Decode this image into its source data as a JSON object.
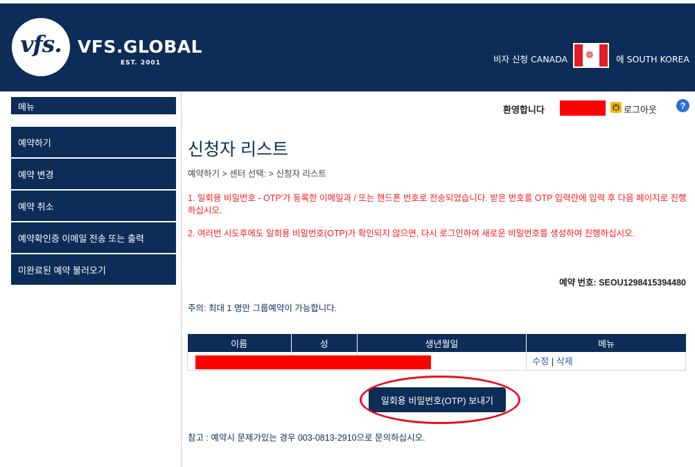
{
  "header": {
    "logo_text": "vfs.",
    "brand": "VFS.GLOBAL",
    "established": "EST. 2001",
    "visa_prefix": "비자 신청 CANADA",
    "flag_icon": "canada-flag-icon",
    "location_text": "에 SOUTH KOREA",
    "colors": {
      "navy": "#0d2c57",
      "red": "#e01e24"
    }
  },
  "sidebar": {
    "title": "메뉴",
    "items": [
      {
        "label": "예약하기"
      },
      {
        "label": "예약 변경"
      },
      {
        "label": "예약 취소"
      },
      {
        "label": "예약확인증 이메일 전송 또는 출력"
      },
      {
        "label": "미완료된 예약 불러오기"
      }
    ]
  },
  "topbar": {
    "welcome": "환영합니다",
    "logout_label": "로그아웃",
    "help_label": "?"
  },
  "main": {
    "title": "신청자 리스트",
    "breadcrumb": "예약하기  >  센터 선택:  >  신청자 리스트",
    "notice1": "1. 일회용 비밀번호 - OTP'가 등록한 이메일과 / 또는 핸드폰 번호로 전송되었습니다. 받은 번호를 OTP 입력란에 입력 후 다음 페이지로 진행하십시오.",
    "notice2": "2. 여러번 시도후에도 일회용 비밀번호(OTP)가 확인되지 않으면, 다시 로그인하여 새로운 비밀번호를 생성하여 진행하십시오.",
    "booking_number": "예약 번호: SEOU1298415394480",
    "group_note": "주의: 최대 1 명만 그룹예약이 가능합니다.",
    "table": {
      "headers": [
        "이름",
        "성",
        "생년월일",
        "메뉴"
      ],
      "row_actions": {
        "edit": "수정",
        "separator": " | ",
        "delete": "삭제"
      }
    },
    "otp_button": "일회용 비밀번호(OTP) 보내기",
    "footnote": "참고 : 예약시 문제가있는 경우 003-0813-2910으로 문의하십시오."
  }
}
